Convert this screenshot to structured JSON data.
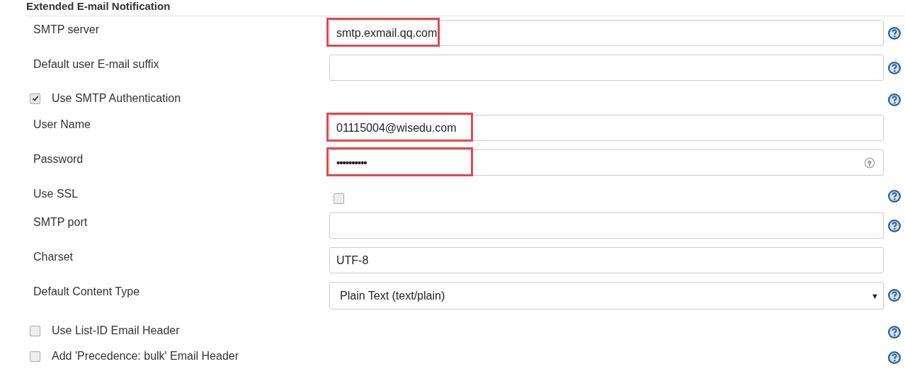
{
  "section": {
    "title": "Extended E-mail Notification"
  },
  "rows": [
    {
      "kind": "text",
      "label": "SMTP server",
      "value": "smtp.exmail.qq.com",
      "help": true,
      "highlighted": true
    },
    {
      "kind": "text",
      "label": "Default user E-mail suffix",
      "help": true,
      "highlighted": false
    },
    {
      "kind": "check",
      "label": "Use SMTP Authentication",
      "checked": true,
      "help": true
    },
    {
      "kind": "text",
      "label": "User Name",
      "value": "01115004@wisedu.com",
      "help": false,
      "highlighted": true
    },
    {
      "kind": "password",
      "label": "Password",
      "value": "••••••••••",
      "help": false,
      "highlighted": true
    },
    {
      "kind": "fieldcheck",
      "label": "Use SSL",
      "checked": false,
      "help": true
    },
    {
      "kind": "text",
      "label": "SMTP port",
      "help": true,
      "highlighted": false
    },
    {
      "kind": "text",
      "label": "Charset",
      "value": "UTF-8",
      "help": false,
      "highlighted": false
    },
    {
      "kind": "select",
      "label": "Default Content Type",
      "value": "Plain Text (text/plain)",
      "caret": "▼",
      "help": true
    },
    {
      "kind": "check",
      "label": "Use List-ID Email Header",
      "checked": false,
      "help": true
    },
    {
      "kind": "check",
      "label": "Add 'Precedence: bulk' Email Header",
      "checked": false,
      "help": true
    }
  ]
}
